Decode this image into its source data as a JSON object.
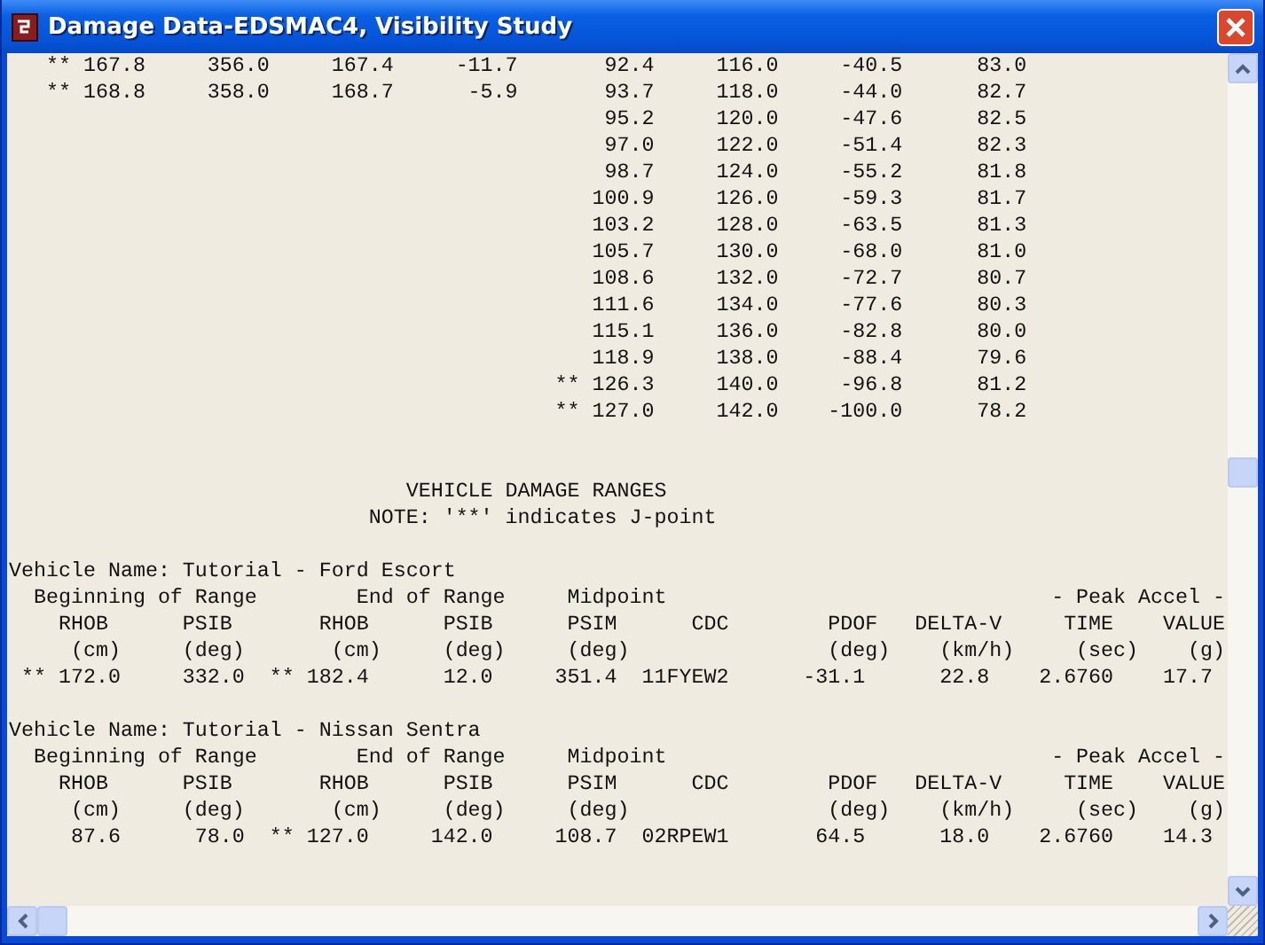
{
  "window": {
    "title": "Damage Data-EDSMAC4, Visibility Study"
  },
  "table_rows": [
    "   ** 167.8     356.0     167.4     -11.7       92.4     116.0     -40.5      83.0",
    "   ** 168.8     358.0     168.7      -5.9       93.7     118.0     -44.0      82.7",
    "                                                95.2     120.0     -47.6      82.5",
    "                                                97.0     122.0     -51.4      82.3",
    "                                                98.7     124.0     -55.2      81.8",
    "                                               100.9     126.0     -59.3      81.7",
    "                                               103.2     128.0     -63.5      81.3",
    "                                               105.7     130.0     -68.0      81.0",
    "                                               108.6     132.0     -72.7      80.7",
    "                                               111.6     134.0     -77.6      80.3",
    "                                               115.1     136.0     -82.8      80.0",
    "                                               118.9     138.0     -88.4      79.6",
    "                                            ** 126.3     140.0     -96.8      81.2",
    "                                            ** 127.0     142.0    -100.0      78.2"
  ],
  "heading_lines": [
    "                                VEHICLE DAMAGE RANGES",
    "                             NOTE: '**' indicates J-point"
  ],
  "vehicles": [
    {
      "lines": [
        "Vehicle Name: Tutorial - Ford Escort",
        "  Beginning of Range        End of Range     Midpoint                               - Peak Accel -",
        "    RHOB      PSIB       RHOB      PSIB      PSIM      CDC        PDOF   DELTA-V     TIME    VALUE",
        "     (cm)     (deg)       (cm)     (deg)     (deg)                (deg)    (km/h)     (sec)    (g)",
        " ** 172.0     332.0  ** 182.4      12.0     351.4  11FYEW2      -31.1      22.8    2.6760    17.7"
      ]
    },
    {
      "lines": [
        "Vehicle Name: Tutorial - Nissan Sentra",
        "  Beginning of Range        End of Range     Midpoint                               - Peak Accel -",
        "    RHOB      PSIB       RHOB      PSIB      PSIM      CDC        PDOF   DELTA-V     TIME    VALUE",
        "     (cm)     (deg)       (cm)     (deg)     (deg)                (deg)    (km/h)     (sec)    (g)",
        "     87.6      78.0  ** 127.0     142.0     108.7  02RPEW1       64.5      18.0    2.6760    14.3"
      ]
    }
  ]
}
